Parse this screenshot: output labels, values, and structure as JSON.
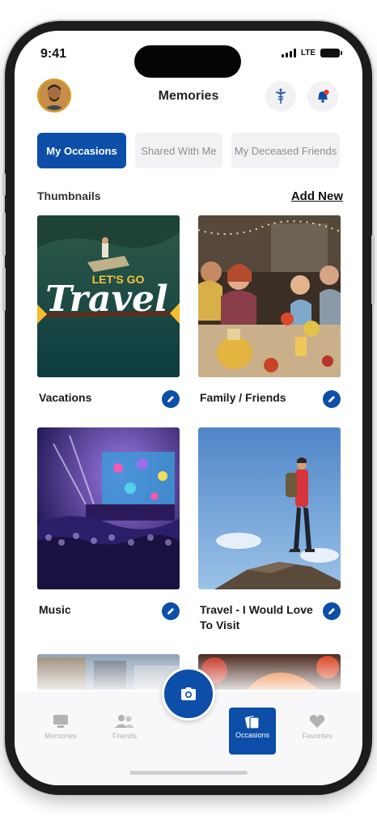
{
  "status": {
    "time": "9:41",
    "network": "LTE"
  },
  "header": {
    "title": "Memories"
  },
  "tabs": [
    {
      "label": "My Occasions",
      "active": true
    },
    {
      "label": "Shared With Me",
      "active": false
    },
    {
      "label": "My Deceased Friends",
      "active": false
    }
  ],
  "section": {
    "label": "Thumbnails",
    "add_new": "Add New"
  },
  "cards": [
    {
      "label": "Vacations",
      "overlay_small": "LET'S GO",
      "overlay_big": "Travel"
    },
    {
      "label": "Family / Friends"
    },
    {
      "label": "Music"
    },
    {
      "label": "Travel - I Would Love To Visit"
    }
  ],
  "nav": [
    {
      "label": "Memories",
      "icon": "monitor-icon"
    },
    {
      "label": "Friends",
      "icon": "people-icon"
    },
    {
      "label": "Occasions",
      "icon": "cards-icon",
      "active": true
    },
    {
      "label": "Favorites",
      "icon": "heart-icon"
    }
  ],
  "colors": {
    "accent": "#0c4ea8",
    "inactive": "#b2b2b7"
  }
}
